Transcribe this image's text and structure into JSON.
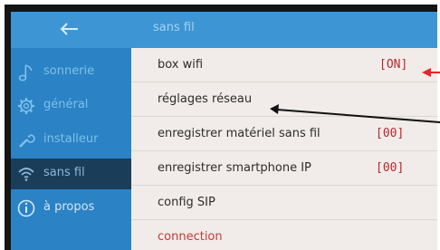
{
  "header": {
    "title": "sans fil",
    "back_icon": "arrow-left-icon"
  },
  "sidebar": {
    "items": [
      {
        "label": "sonnerie",
        "icon": "music-note-icon"
      },
      {
        "label": "général",
        "icon": "gear-icon"
      },
      {
        "label": "installeur",
        "icon": "wrench-icon"
      },
      {
        "label": "sans fil",
        "icon": "wifi-icon",
        "active": true
      },
      {
        "label": "à propos",
        "icon": "info-icon"
      }
    ]
  },
  "settings": {
    "rows": [
      {
        "label": "box wifi",
        "value": "[ON]"
      },
      {
        "label": "réglages réseau",
        "value": ""
      },
      {
        "label": "enregistrer matériel sans fil",
        "value": "[00]"
      },
      {
        "label": "enregistrer smartphone IP",
        "value": "[00]"
      },
      {
        "label": "config SIP",
        "value": ""
      },
      {
        "label": "connection",
        "value": ""
      }
    ]
  },
  "colors": {
    "sidebar": "#2b82c4",
    "header": "#3d96d3",
    "active_item": "#1a3d5a",
    "content_bg": "#f1ece9",
    "value_red": "#b9262c",
    "annotation_red": "#e8262a"
  }
}
